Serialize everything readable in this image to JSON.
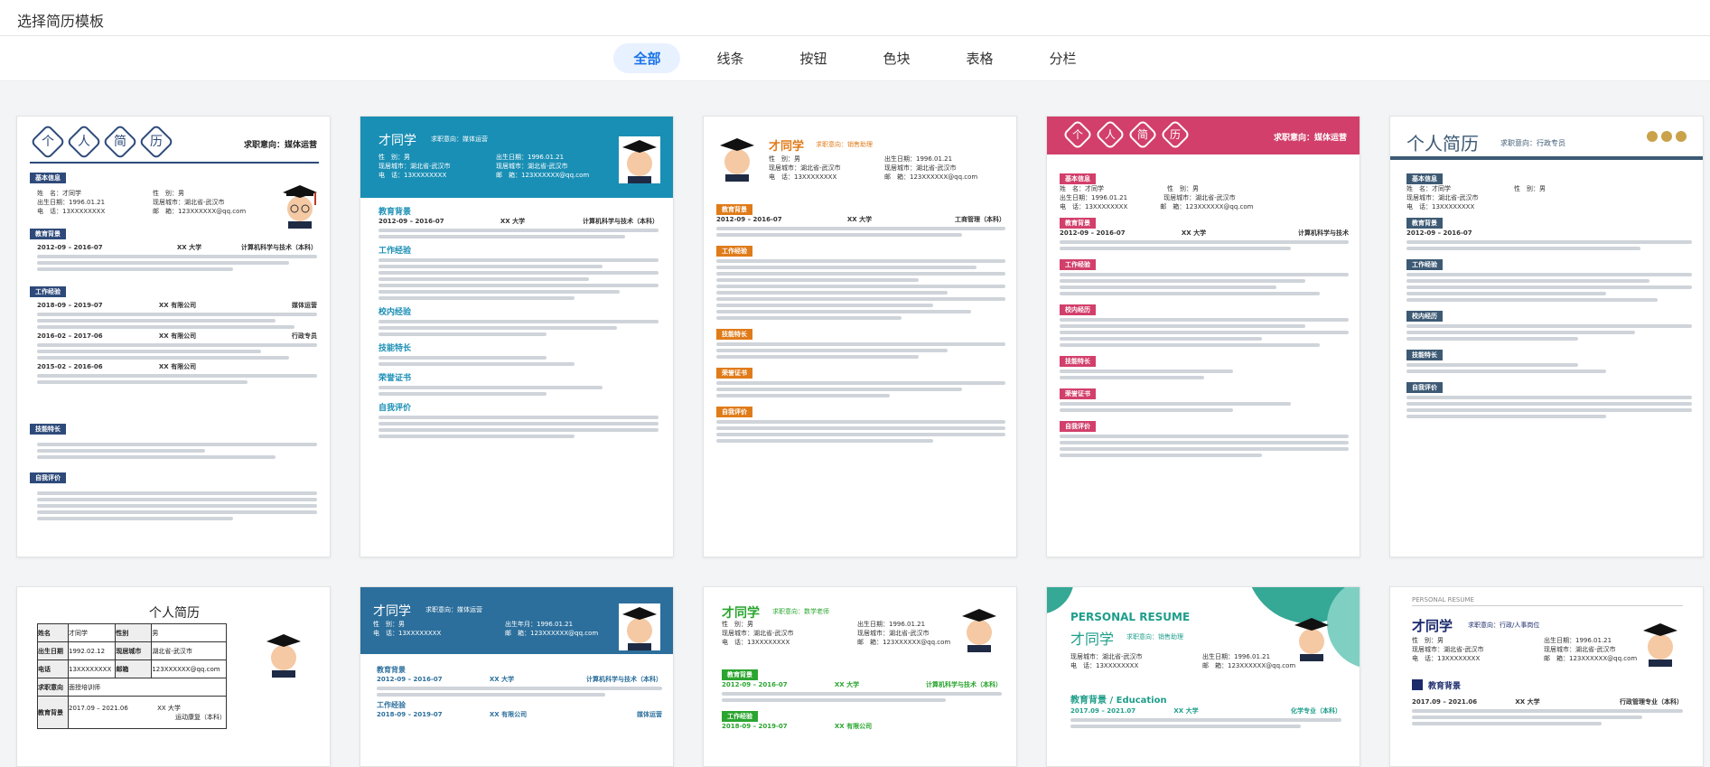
{
  "window": {
    "title": "选择简历模板"
  },
  "tabs": [
    {
      "label": "全部",
      "active": true
    },
    {
      "label": "线条",
      "active": false
    },
    {
      "label": "按钮",
      "active": false
    },
    {
      "label": "色块",
      "active": false
    },
    {
      "label": "表格",
      "active": false
    },
    {
      "label": "分栏",
      "active": false
    }
  ],
  "cards": {
    "c1": {
      "chars": [
        "个",
        "人",
        "简",
        "历"
      ],
      "intention": "求职意向：媒体运营",
      "sections": [
        "基本信息",
        "教育背景",
        "工作经验",
        "技能特长",
        "自我评价"
      ],
      "school": "XX 大学",
      "major": "计算机科学与技术（本科）",
      "date1": "2012-09 – 2016-07",
      "date2": "2018-09 – 2019-07",
      "date3": "2016-02 – 2017-06",
      "date4": "2015-02 – 2016-06",
      "company": "XX 有限公司",
      "role1": "媒体运营",
      "role2": "行政专员",
      "accent": "#2e4a7a"
    },
    "c2": {
      "name": "才同学",
      "intention": "求职意向：媒体运营",
      "sections": [
        "教育背景",
        "工作经验",
        "校内经验",
        "技能特长",
        "荣誉证书",
        "自我评价"
      ],
      "date1": "2012-09 – 2016-07",
      "school": "XX 大学",
      "major": "计算机科学与技术（本科）",
      "accent": "#1a8fb5"
    },
    "c3": {
      "name": "才同学",
      "intention": "求职意向：销售助理",
      "sections": [
        "教育背景",
        "工作经验",
        "技能特长",
        "荣誉证书",
        "自我评价"
      ],
      "date1": "2012-09 – 2016-07",
      "school": "XX 大学",
      "major": "工商管理（本科）",
      "accent": "#e07b1a"
    },
    "c4": {
      "chars": [
        "个",
        "人",
        "简",
        "历"
      ],
      "intention": "求职意向：媒体运营",
      "sections": [
        "基本信息",
        "教育背景",
        "工作经验",
        "校内经历",
        "技能特长",
        "荣誉证书",
        "自我评价"
      ],
      "school": "XX 大学",
      "major": "计算机科学与技术",
      "date1": "2012-09 – 2016-07",
      "accent": "#d23f6b"
    },
    "c5": {
      "title": "个人简历",
      "intention": "求职意向：行政专员",
      "sections": [
        "基本信息",
        "教育背景",
        "工作经验",
        "校内经历",
        "技能特长",
        "自我评价"
      ],
      "date1": "2012-09 – 2016-07",
      "accent": "#3d5a74"
    },
    "c6": {
      "title": "个人简历",
      "labels": [
        "姓名",
        "出生日期",
        "电话",
        "求职意向",
        "教育背景"
      ],
      "values": [
        "才同学",
        "1992.02.12",
        "13XXXXXXXX",
        "面授培训师"
      ],
      "right_labels": [
        "性别",
        "现居城市",
        "邮箱"
      ],
      "right_values": [
        "男",
        "湖北省-武汉市",
        "123XXXXXX@qq.com"
      ],
      "date1": "2017.09 – 2021.06",
      "school": "XX 大学",
      "major": "运动康复（本科）"
    },
    "c7": {
      "name": "才同学",
      "intention": "求职意向：媒体运营",
      "birth": "出生年月：1996.01.21",
      "sections": [
        "教育背景",
        "工作经验"
      ],
      "date1": "2012-09 – 2016-07",
      "date2": "2018-09 – 2019-07",
      "school": "XX 大学",
      "major": "计算机科学与技术（本科）",
      "company": "XX 有限公司",
      "role": "媒体运营",
      "accent": "#2c6f9c"
    },
    "c8": {
      "name": "才同学",
      "intention": "求职意向：数学老师",
      "sections": [
        "教育背景",
        "工作经验"
      ],
      "date1": "2012-09 – 2016-07",
      "date2": "2018-09 – 2019-07",
      "school": "XX 大学",
      "major": "计算机科学与技术（本科）",
      "company": "XX 有限公司",
      "accent": "#2aa52f"
    },
    "c9": {
      "banner": "PERSONAL RESUME",
      "name": "才同学",
      "intention": "求职意向：销售助理",
      "section": "教育背景 / Education",
      "date1": "2017.09 – 2021.07",
      "school": "XX 大学",
      "major": "化学专业（本科）",
      "accent": "#1f9e8b"
    },
    "c10": {
      "banner": "PERSONAL RESUME",
      "name": "才同学",
      "intention": "求职意向：行政/人事岗位",
      "section": "教育背景",
      "date1": "2017.09 – 2021.06",
      "school": "XX 大学",
      "major": "行政管理专业（本科）",
      "accent": "#1b2a6b"
    }
  },
  "common": {
    "gender": "性　别：男",
    "city": "现居城市：湖北省-武汉市",
    "phone": "电　话：13XXXXXXXX",
    "email": "邮　箱：123XXXXXX@qq.com",
    "birth": "出生日期：1996.01.21",
    "name_row": "姓　名：才同学"
  }
}
